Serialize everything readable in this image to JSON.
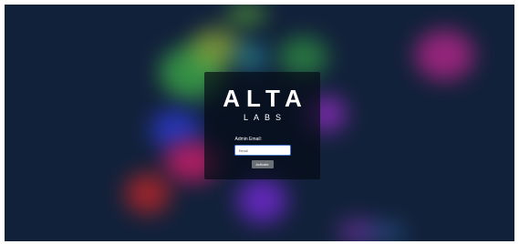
{
  "brand": {
    "main": "ALTA",
    "sub": "LABS"
  },
  "login": {
    "email_label": "Admin Email:",
    "email_placeholder": "Email",
    "email_value": "",
    "activate_label": "Activate"
  },
  "colors": {
    "background": "#12213a",
    "card": "#050a14",
    "button": "#6c7077",
    "input_border": "#4a74c9"
  }
}
